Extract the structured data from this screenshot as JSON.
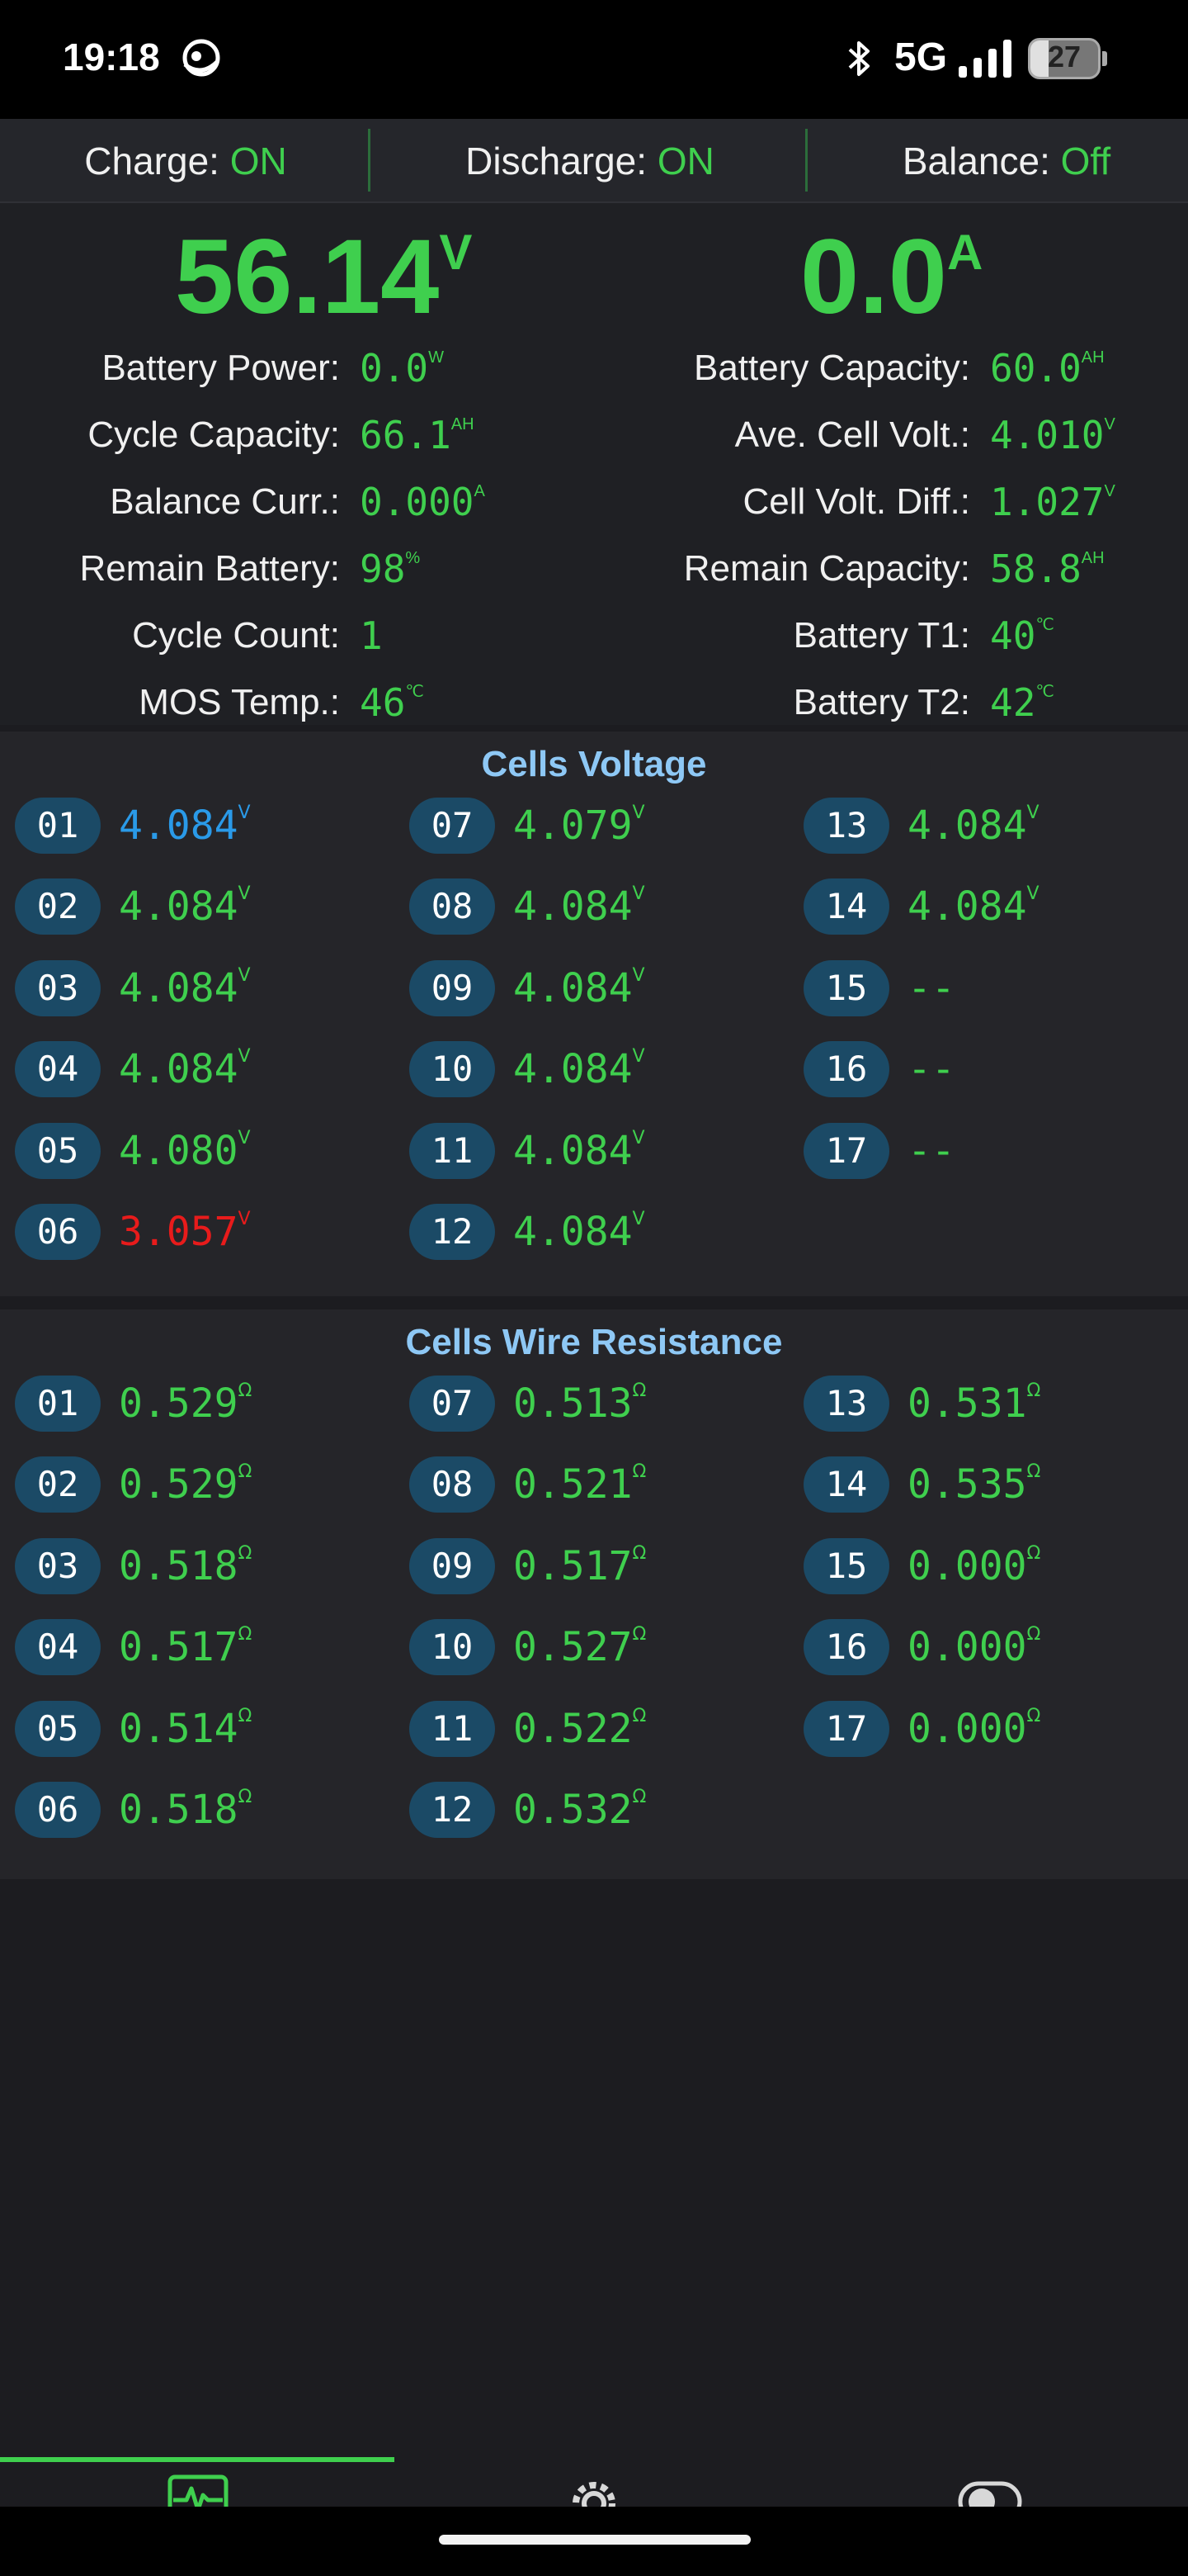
{
  "status_bar": {
    "time": "19:18",
    "network": "5G",
    "battery_level": "27"
  },
  "switches": [
    {
      "label": "Charge:",
      "value": "ON"
    },
    {
      "label": "Discharge:",
      "value": "ON"
    },
    {
      "label": "Balance:",
      "value": "Off"
    }
  ],
  "summary": {
    "voltage": {
      "value": "56.14",
      "unit": "V"
    },
    "current": {
      "value": "0.0",
      "unit": "A"
    },
    "left": [
      {
        "label": "Battery Power:",
        "value": "0.0",
        "unit": "W"
      },
      {
        "label": "Cycle Capacity:",
        "value": "66.1",
        "unit": "AH"
      },
      {
        "label": "Balance Curr.:",
        "value": "0.000",
        "unit": "A"
      },
      {
        "label": "Remain Battery:",
        "value": "98",
        "unit": "%"
      },
      {
        "label": "Cycle Count:",
        "value": "1",
        "unit": ""
      },
      {
        "label": "MOS Temp.:",
        "value": "46",
        "unit": "℃"
      }
    ],
    "right": [
      {
        "label": "Battery Capacity:",
        "value": "60.0",
        "unit": "AH"
      },
      {
        "label": "Ave. Cell Volt.:",
        "value": "4.010",
        "unit": "V"
      },
      {
        "label": "Cell Volt. Diff.:",
        "value": "1.027",
        "unit": "V"
      },
      {
        "label": "Remain Capacity:",
        "value": "58.8",
        "unit": "AH"
      },
      {
        "label": "Battery T1:",
        "value": "40",
        "unit": "℃"
      },
      {
        "label": "Battery T2:",
        "value": "42",
        "unit": "℃"
      }
    ]
  },
  "cells_voltage": {
    "title": "Cells Voltage",
    "unit": "V",
    "cells": [
      {
        "index": "01",
        "value": "4.084",
        "state": "max"
      },
      {
        "index": "02",
        "value": "4.084",
        "state": "normal"
      },
      {
        "index": "03",
        "value": "4.084",
        "state": "normal"
      },
      {
        "index": "04",
        "value": "4.084",
        "state": "normal"
      },
      {
        "index": "05",
        "value": "4.080",
        "state": "normal"
      },
      {
        "index": "06",
        "value": "3.057",
        "state": "min"
      },
      {
        "index": "07",
        "value": "4.079",
        "state": "normal"
      },
      {
        "index": "08",
        "value": "4.084",
        "state": "normal"
      },
      {
        "index": "09",
        "value": "4.084",
        "state": "normal"
      },
      {
        "index": "10",
        "value": "4.084",
        "state": "normal"
      },
      {
        "index": "11",
        "value": "4.084",
        "state": "normal"
      },
      {
        "index": "12",
        "value": "4.084",
        "state": "normal"
      },
      {
        "index": "13",
        "value": "4.084",
        "state": "normal"
      },
      {
        "index": "14",
        "value": "4.084",
        "state": "normal"
      },
      {
        "index": "15",
        "value": "--",
        "state": "empty"
      },
      {
        "index": "16",
        "value": "--",
        "state": "empty"
      },
      {
        "index": "17",
        "value": "--",
        "state": "empty"
      }
    ]
  },
  "cells_resistance": {
    "title": "Cells Wire Resistance",
    "unit": "Ω",
    "cells": [
      {
        "index": "01",
        "value": "0.529"
      },
      {
        "index": "02",
        "value": "0.529"
      },
      {
        "index": "03",
        "value": "0.518"
      },
      {
        "index": "04",
        "value": "0.517"
      },
      {
        "index": "05",
        "value": "0.514"
      },
      {
        "index": "06",
        "value": "0.518"
      },
      {
        "index": "07",
        "value": "0.513"
      },
      {
        "index": "08",
        "value": "0.521"
      },
      {
        "index": "09",
        "value": "0.517"
      },
      {
        "index": "10",
        "value": "0.527"
      },
      {
        "index": "11",
        "value": "0.522"
      },
      {
        "index": "12",
        "value": "0.532"
      },
      {
        "index": "13",
        "value": "0.531"
      },
      {
        "index": "14",
        "value": "0.535"
      },
      {
        "index": "15",
        "value": "0.000"
      },
      {
        "index": "16",
        "value": "0.000"
      },
      {
        "index": "17",
        "value": "0.000"
      }
    ]
  },
  "bottom_nav": {
    "items": [
      {
        "icon": "pulse-monitor-icon",
        "active": true
      },
      {
        "icon": "gear-icon",
        "active": false
      },
      {
        "icon": "toggle-icon",
        "active": false
      }
    ]
  },
  "colors": {
    "accent_green": "#3fcf4e",
    "max_blue": "#2a9ae8",
    "min_red": "#e81b1b",
    "index_badge": "#1b4a66",
    "title_blue": "#8ec8f5"
  }
}
